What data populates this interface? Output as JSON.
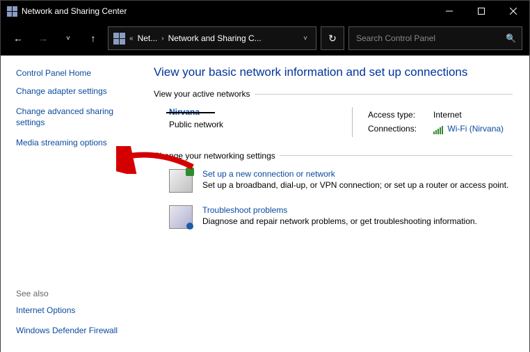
{
  "window": {
    "title": "Network and Sharing Center"
  },
  "nav": {
    "breadcrumb": {
      "item1": "Net...",
      "item2": "Network and Sharing C..."
    },
    "searchPlaceholder": "Search Control Panel"
  },
  "sidebar": {
    "home": "Control Panel Home",
    "adapter": "Change adapter settings",
    "advanced": "Change advanced sharing settings",
    "media": "Media streaming options",
    "seeAlso": "See also",
    "internetOptions": "Internet Options",
    "firewall": "Windows Defender Firewall"
  },
  "main": {
    "heading": "View your basic network information and set up connections",
    "activeNetworksLabel": "View your active networks",
    "network": {
      "name": "Nirvana",
      "type": "Public network",
      "accessTypeLabel": "Access type:",
      "accessTypeValue": "Internet",
      "connectionsLabel": "Connections:",
      "connectionsValue": "Wi-Fi (Nirvana)"
    },
    "changeSettingsLabel": "Change your networking settings",
    "setup": {
      "title": "Set up a new connection or network",
      "desc": "Set up a broadband, dial-up, or VPN connection; or set up a router or access point."
    },
    "troubleshoot": {
      "title": "Troubleshoot problems",
      "desc": "Diagnose and repair network problems, or get troubleshooting information."
    }
  }
}
